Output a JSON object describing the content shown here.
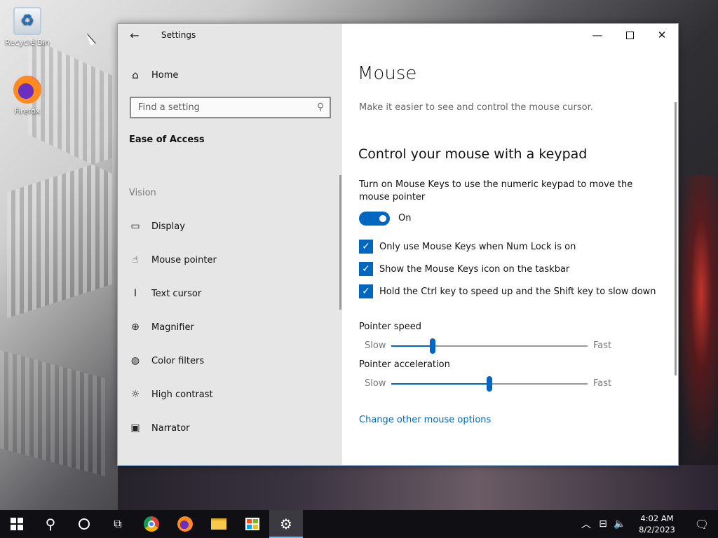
{
  "desktop": {
    "icons": [
      {
        "label": "Recycle Bin",
        "icon": "recycle-bin-icon"
      },
      {
        "label": "Firefox",
        "icon": "firefox-icon"
      }
    ]
  },
  "window": {
    "title": "Settings",
    "colors": {
      "accent": "#0067c0",
      "sidebar_bg": "#e6e6e6",
      "link": "#0067b8"
    }
  },
  "sidebar": {
    "home_label": "Home",
    "search_placeholder": "Find a setting",
    "section_label": "Ease of Access",
    "group_label": "Vision",
    "items": [
      {
        "label": "Display",
        "icon": "monitor-icon"
      },
      {
        "label": "Mouse pointer",
        "icon": "mouse-pointer-icon"
      },
      {
        "label": "Text cursor",
        "icon": "text-cursor-icon"
      },
      {
        "label": "Magnifier",
        "icon": "magnifier-icon"
      },
      {
        "label": "Color filters",
        "icon": "palette-icon"
      },
      {
        "label": "High contrast",
        "icon": "sun-icon"
      },
      {
        "label": "Narrator",
        "icon": "narrator-icon"
      }
    ]
  },
  "main": {
    "title": "Mouse",
    "description": "Make it easier to see and control the mouse cursor.",
    "subtitle": "Control your mouse with a keypad",
    "mouse_keys_description": "Turn on Mouse Keys to use the numeric keypad to move the mouse pointer",
    "toggle_state": "On",
    "checkboxes": [
      {
        "label": "Only use Mouse Keys when Num Lock is on",
        "checked": true
      },
      {
        "label": "Show the Mouse Keys icon on the taskbar",
        "checked": true
      },
      {
        "label": "Hold the Ctrl key to speed up and the Shift key to slow down",
        "checked": true
      }
    ],
    "sliders": [
      {
        "label": "Pointer speed",
        "min_label": "Slow",
        "max_label": "Fast",
        "value": 0.21
      },
      {
        "label": "Pointer acceleration",
        "min_label": "Slow",
        "max_label": "Fast",
        "value": 0.5
      }
    ],
    "link": "Change other mouse options"
  },
  "taskbar": {
    "apps": [
      "start-icon",
      "search-icon",
      "cortana-icon",
      "task-view-icon",
      "chrome-icon",
      "firefox-icon",
      "file-explorer-icon",
      "store-icon",
      "settings-gear-icon"
    ],
    "time": "4:02 AM",
    "date": "8/2/2023"
  }
}
